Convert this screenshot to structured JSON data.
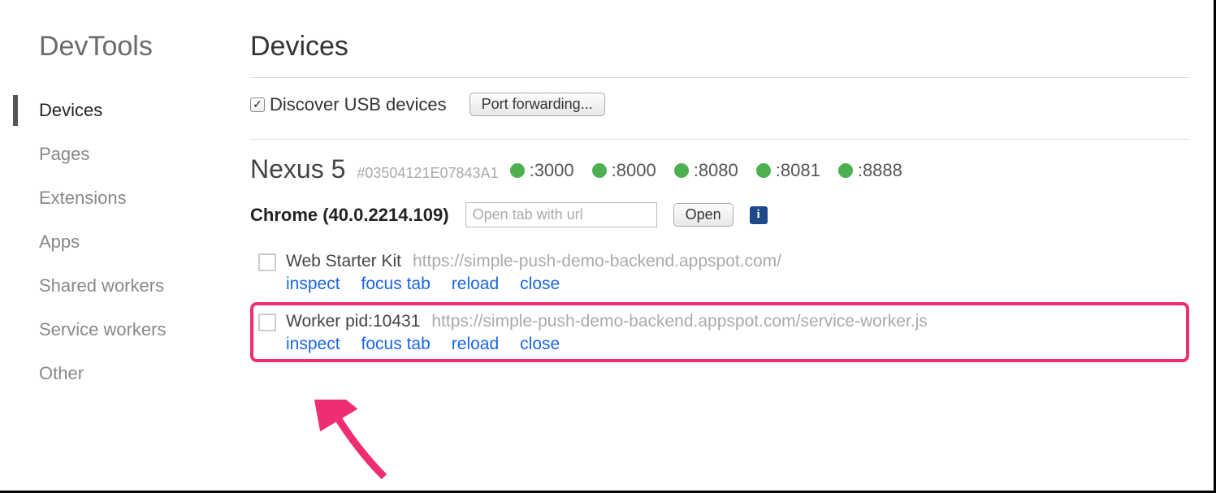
{
  "sidebar": {
    "title": "DevTools",
    "items": [
      {
        "label": "Devices",
        "active": true
      },
      {
        "label": "Pages"
      },
      {
        "label": "Extensions"
      },
      {
        "label": "Apps"
      },
      {
        "label": "Shared workers"
      },
      {
        "label": "Service workers"
      },
      {
        "label": "Other"
      }
    ]
  },
  "main": {
    "title": "Devices",
    "discover_label": "Discover USB devices",
    "port_forward_btn": "Port forwarding...",
    "device": {
      "name": "Nexus 5",
      "id": "#03504121E07843A1",
      "ports": [
        ":3000",
        ":8000",
        ":8080",
        ":8081",
        ":8888"
      ]
    },
    "browser": {
      "label": "Chrome (40.0.2214.109)",
      "url_placeholder": "Open tab with url",
      "open_btn": "Open"
    },
    "targets": [
      {
        "title": "Web Starter Kit",
        "url": "https://simple-push-demo-backend.appspot.com/",
        "actions": [
          "inspect",
          "focus tab",
          "reload",
          "close"
        ],
        "highlighted": false
      },
      {
        "title": "Worker pid:10431",
        "url": "https://simple-push-demo-backend.appspot.com/service-worker.js",
        "actions": [
          "inspect",
          "focus tab",
          "reload",
          "close"
        ],
        "highlighted": true
      }
    ]
  }
}
